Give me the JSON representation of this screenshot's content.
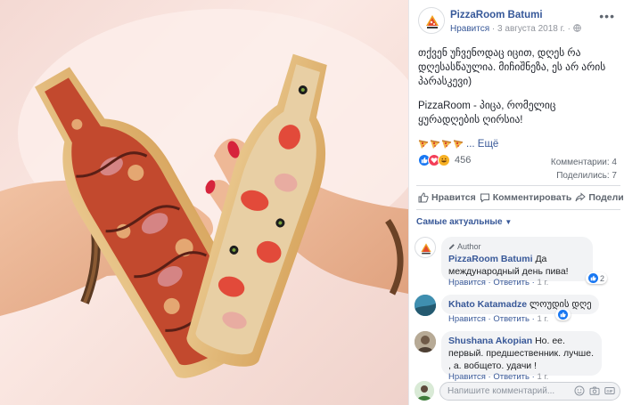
{
  "post": {
    "page_name": "PizzaRoom Batumi",
    "like_label": "Нравится",
    "date": "3 августа 2018 г.",
    "separator": "·",
    "more_icon": "ellipsis-icon",
    "text_line1": "თქვენ უჩვენოდაც იცით, დღეს რა დღესასწაულია. მიჩიშნეზა, ეს არ არის პარასკევი)",
    "text_line2": "PizzaRoom - პიცა, რომელიც ყურადღების ღირსია!",
    "more_label": "... Ещё",
    "reaction_count": "456",
    "comments_count": "Комментарии: 4",
    "shares_count": "Поделились: 7"
  },
  "actions": {
    "like": "Нравится",
    "comment": "Комментировать",
    "share": "Поделиться"
  },
  "sort_label": "Самые актуальные",
  "comments": [
    {
      "badge": "Author",
      "author": "PizzaRoom Batumi",
      "text": "Да международный день пива!",
      "like": "Нравится",
      "reply": "Ответить",
      "age": "1 г.",
      "likes": "2"
    },
    {
      "author": "Khato Katamadze",
      "text": "ლოუდის დღე",
      "like": "Нравится",
      "reply": "Ответить",
      "age": "1 г."
    },
    {
      "author": "Shushana Akopian",
      "text": "Но. ее. первый. предшественник. лучше. , а. вобщето. удачи !",
      "like": "Нравится",
      "reply": "Ответить",
      "age": "1 г."
    }
  ],
  "composer": {
    "placeholder": "Напишите комментарий..."
  },
  "colors": {
    "link": "#385898",
    "like_blue": "#1877f2",
    "bubble": "#f2f3f5"
  }
}
